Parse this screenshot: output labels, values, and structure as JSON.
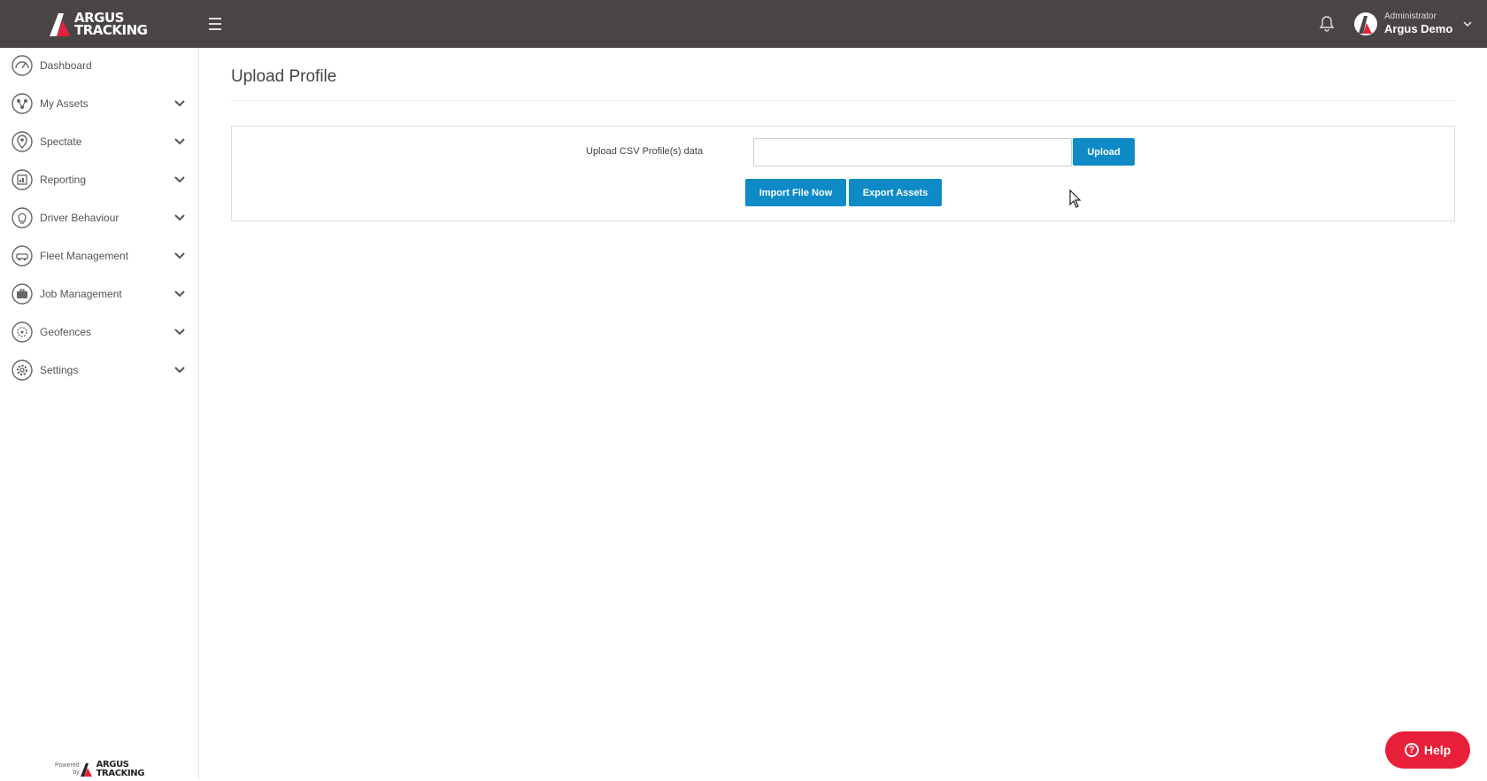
{
  "brand": {
    "line1": "ARGUS",
    "line2": "TRACKING"
  },
  "user": {
    "role": "Administrator",
    "name": "Argus Demo"
  },
  "sidebar": {
    "items": [
      {
        "label": "Dashboard",
        "icon": "dashboard-icon",
        "expandable": false
      },
      {
        "label": "My Assets",
        "icon": "assets-icon",
        "expandable": true
      },
      {
        "label": "Spectate",
        "icon": "map-pin-icon",
        "expandable": true
      },
      {
        "label": "Reporting",
        "icon": "report-icon",
        "expandable": true
      },
      {
        "label": "Driver Behaviour",
        "icon": "lightbulb-icon",
        "expandable": true
      },
      {
        "label": "Fleet Management",
        "icon": "fleet-icon",
        "expandable": true
      },
      {
        "label": "Job Management",
        "icon": "briefcase-icon",
        "expandable": true
      },
      {
        "label": "Geofences",
        "icon": "geofence-icon",
        "expandable": true
      },
      {
        "label": "Settings",
        "icon": "gear-icon",
        "expandable": true
      }
    ],
    "powered": {
      "small1": "Powered",
      "small2": "by",
      "line1": "ARGUS",
      "line2": "TRACKING"
    }
  },
  "main": {
    "title": "Upload Profile",
    "upload_label": "Upload CSV Profile(s) data",
    "file_value": "",
    "upload_button": "Upload",
    "import_button": "Import File Now",
    "export_button": "Export Assets"
  },
  "help": {
    "label": "Help"
  },
  "colors": {
    "topbar": "#4a4545",
    "accent": "#0e8ac7",
    "help": "#e8203a",
    "logo_red": "#e8203a"
  }
}
